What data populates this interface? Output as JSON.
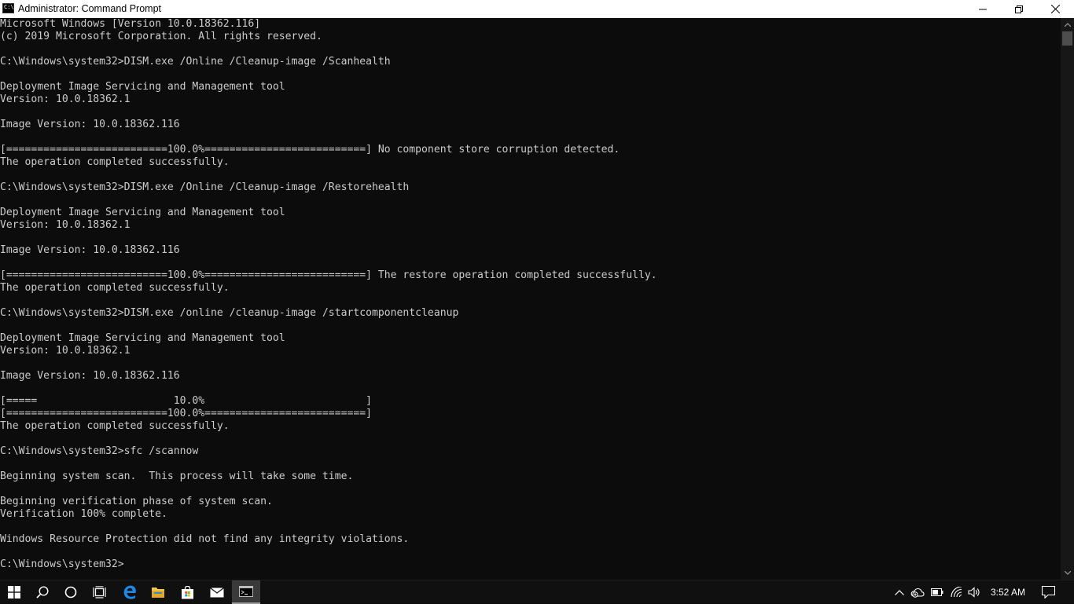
{
  "window": {
    "title": "Administrator: Command Prompt",
    "icon_label": "C:\\."
  },
  "controls": {
    "minimize": "minimize-icon",
    "restore": "restore-icon",
    "close": "close-icon"
  },
  "console": {
    "lines": [
      "Microsoft Windows [Version 10.0.18362.116]",
      "(c) 2019 Microsoft Corporation. All rights reserved.",
      "",
      "C:\\Windows\\system32>DISM.exe /Online /Cleanup-image /Scanhealth",
      "",
      "Deployment Image Servicing and Management tool",
      "Version: 10.0.18362.1",
      "",
      "Image Version: 10.0.18362.116",
      "",
      "[==========================100.0%==========================] No component store corruption detected.",
      "The operation completed successfully.",
      "",
      "C:\\Windows\\system32>DISM.exe /Online /Cleanup-image /Restorehealth",
      "",
      "Deployment Image Servicing and Management tool",
      "Version: 10.0.18362.1",
      "",
      "Image Version: 10.0.18362.116",
      "",
      "[==========================100.0%==========================] The restore operation completed successfully.",
      "The operation completed successfully.",
      "",
      "C:\\Windows\\system32>DISM.exe /online /cleanup-image /startcomponentcleanup",
      "",
      "Deployment Image Servicing and Management tool",
      "Version: 10.0.18362.1",
      "",
      "Image Version: 10.0.18362.116",
      "",
      "[=====                      10.0%                          ]",
      "[==========================100.0%==========================]",
      "The operation completed successfully.",
      "",
      "C:\\Windows\\system32>sfc /scannow",
      "",
      "Beginning system scan.  This process will take some time.",
      "",
      "Beginning verification phase of system scan.",
      "Verification 100% complete.",
      "",
      "Windows Resource Protection did not find any integrity violations.",
      "",
      "C:\\Windows\\system32>"
    ]
  },
  "taskbar": {
    "items": [
      {
        "name": "start-button",
        "icon": "windows-logo-icon"
      },
      {
        "name": "search-button",
        "icon": "search-icon"
      },
      {
        "name": "cortana-button",
        "icon": "cortana-circle-icon"
      },
      {
        "name": "task-view-button",
        "icon": "task-view-icon"
      },
      {
        "name": "edge-button",
        "icon": "edge-icon"
      },
      {
        "name": "file-explorer-button",
        "icon": "folder-icon"
      },
      {
        "name": "store-button",
        "icon": "store-bag-icon"
      },
      {
        "name": "mail-button",
        "icon": "mail-icon"
      },
      {
        "name": "command-prompt-button",
        "icon": "command-prompt-icon",
        "active": true
      }
    ],
    "tray": [
      "chevron-up-icon",
      "onedrive-icon",
      "battery-icon",
      "wifi-icon",
      "volume-icon"
    ],
    "clock": "3:52 AM",
    "notification": "action-center-icon"
  },
  "colors": {
    "console_bg": "#0c0c0c",
    "console_text": "#cccccc",
    "titlebar_bg": "#ffffff",
    "taskbar_bg": "#101010",
    "edge_blue": "#1e88e5",
    "folder_yellow": "#f2c649"
  }
}
